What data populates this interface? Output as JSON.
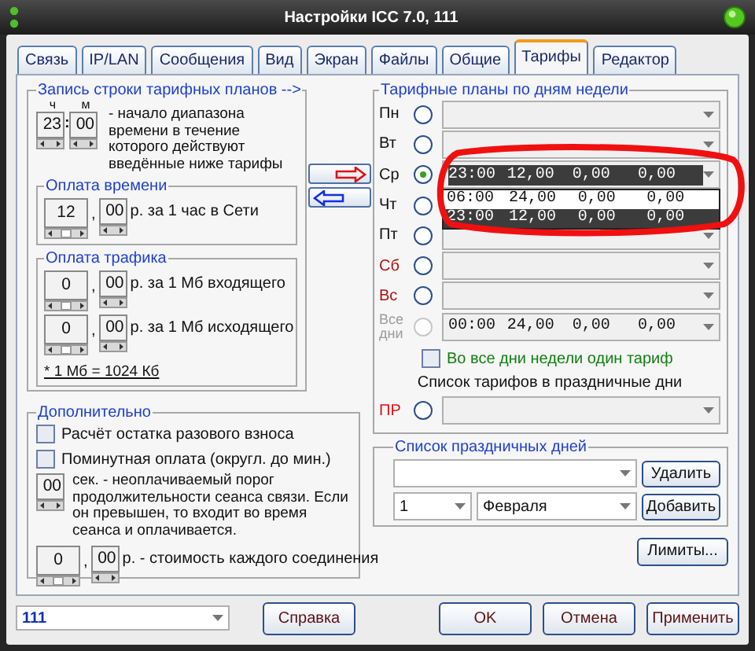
{
  "window": {
    "title": "Настройки ICC 7.0, 111"
  },
  "tabs": [
    {
      "label": "Связь",
      "selected": false
    },
    {
      "label": "IP/LAN",
      "selected": false
    },
    {
      "label": "Сообщения",
      "selected": false
    },
    {
      "label": "Вид",
      "selected": false
    },
    {
      "label": "Экран",
      "selected": false
    },
    {
      "label": "Файлы",
      "selected": false
    },
    {
      "label": "Общие",
      "selected": false
    },
    {
      "label": "Тарифы",
      "selected": true
    },
    {
      "label": "Редактор",
      "selected": false
    }
  ],
  "record_group": {
    "title": "Запись строки тарифных планов -->",
    "hour_label": "ч",
    "minute_label": "м",
    "hours": "23",
    "separator": ":",
    "minutes": "00",
    "description": "- начало диапазона времени в течение которого действуют введённые ниже тарифы"
  },
  "time_payment": {
    "title": "Оплата времени",
    "rubles": "12",
    "separator": ",",
    "kopecks": "00",
    "label": "р. за 1 час в Сети"
  },
  "traffic_payment": {
    "title": "Оплата трафика",
    "rows": [
      {
        "rubles": "0",
        "separator": ",",
        "kopecks": "00",
        "label": "р. за 1 Мб входящего"
      },
      {
        "rubles": "0",
        "separator": ",",
        "kopecks": "00",
        "label": "р. за 1 Мб исходящего"
      }
    ],
    "note": "* 1 Мб = 1024 Кб"
  },
  "extra": {
    "title": "Дополнительно",
    "checkboxes": [
      {
        "label": "Расчёт остатка разового взноса",
        "checked": false
      },
      {
        "label": "Поминутная оплата (округл. до мин.)",
        "checked": false
      }
    ],
    "threshold": {
      "value": "00",
      "label": "сек. - неоплачиваемый порог продолжительности сеанса связи. Если он превышен, то входит во время сеанса и оплачивается."
    },
    "connection_cost": {
      "rubles": "0",
      "separator": ",",
      "kopecks": "00",
      "label": "р. - стоимость каждого соединения"
    }
  },
  "week_plans": {
    "title": "Тарифные планы по дням недели",
    "days": [
      {
        "label": "Пн",
        "kind": "weekday",
        "selected": false
      },
      {
        "label": "Вт",
        "kind": "weekday",
        "selected": false
      },
      {
        "label": "Ср",
        "kind": "weekday",
        "selected": true,
        "value": [
          "23:00",
          "12,00",
          "0,00",
          "0,00"
        ],
        "open": true,
        "items": [
          {
            "cells": [
              "06:00",
              "24,00",
              "0,00",
              "0,00"
            ],
            "selected": false
          },
          {
            "cells": [
              "23:00",
              "12,00",
              "0,00",
              "0,00"
            ],
            "selected": true
          }
        ]
      },
      {
        "label": "Чт",
        "kind": "weekday",
        "selected": false
      },
      {
        "label": "Пт",
        "kind": "weekday",
        "selected": false
      },
      {
        "label": "Сб",
        "kind": "weekend",
        "selected": false
      },
      {
        "label": "Вс",
        "kind": "weekend",
        "selected": false
      },
      {
        "label": "Все дни",
        "kind": "all",
        "selected": false,
        "value": [
          "00:00",
          "24,00",
          "0,00",
          "0,00"
        ]
      }
    ],
    "same_tariff": {
      "label": "Во все дни недели один тариф",
      "checked": false
    },
    "holiday_caption": "Список тарифов в праздничные дни",
    "holiday_row": {
      "label": "ПР",
      "selected": false
    }
  },
  "holiday_list": {
    "title": "Список праздничных дней",
    "delete_button": "Удалить",
    "day": "1",
    "month": "Февраля",
    "add_button": "Добавить"
  },
  "limits_button": "Лимиты...",
  "footer": {
    "profile": "111",
    "help_button": "Справка",
    "buttons": [
      "OK",
      "Отмена",
      "Применить"
    ]
  }
}
